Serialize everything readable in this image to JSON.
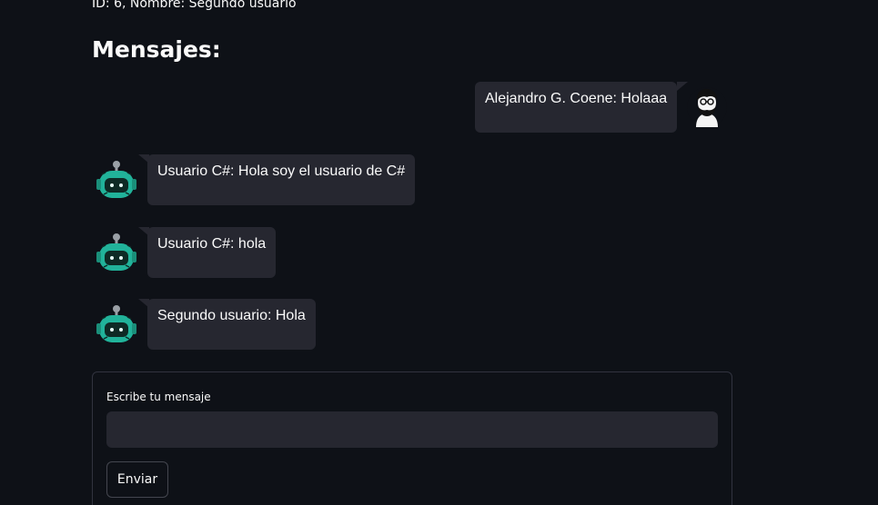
{
  "header": {
    "user_info": "ID: 6, Nombre: Segundo usuario",
    "title": "Mensajes:"
  },
  "messages": [
    {
      "side": "right",
      "avatar_icon": "human-avatar-icon",
      "text": "Alejandro G. Coene: Holaaa"
    },
    {
      "side": "left",
      "avatar_icon": "bot-avatar-icon",
      "text": "Usuario C#: Hola soy el usuario de C#"
    },
    {
      "side": "left",
      "avatar_icon": "bot-avatar-icon",
      "text": "Usuario C#: hola"
    },
    {
      "side": "left",
      "avatar_icon": "bot-avatar-icon",
      "text": "Segundo usuario: Hola"
    }
  ],
  "form": {
    "input_label": "Escribe tu mensaje",
    "input_value": "",
    "send_label": "Enviar"
  },
  "colors": {
    "background": "#0e1117",
    "bubble": "#262730",
    "bot_teal": "#21b39a"
  }
}
